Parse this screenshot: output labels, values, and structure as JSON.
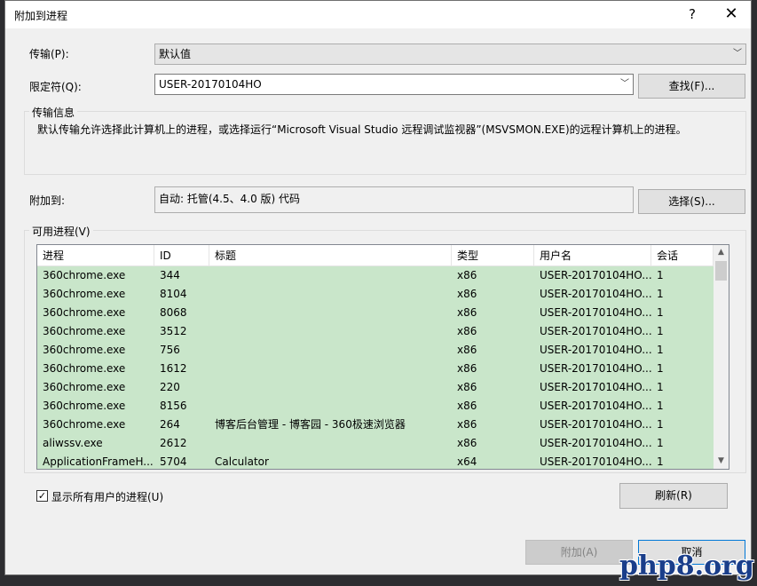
{
  "dialog": {
    "title": "附加到进程",
    "help_glyph": "?",
    "close_glyph": "✕"
  },
  "transport": {
    "label": "传输(P):",
    "value": "默认值"
  },
  "qualifier": {
    "label": "限定符(Q):",
    "value": "USER-20170104HO",
    "find_button": "查找(F)..."
  },
  "transport_info": {
    "title": "传输信息",
    "text": "默认传输允许选择此计算机上的进程，或选择运行“Microsoft Visual Studio 远程调试监视器”(MSVSMON.EXE)的远程计算机上的进程。"
  },
  "attach_to": {
    "label": "附加到:",
    "value": "自动: 托管(4.5、4.0 版) 代码",
    "select_button": "选择(S)..."
  },
  "processes": {
    "title": "可用进程(V)",
    "columns": [
      "进程",
      "ID",
      "标题",
      "类型",
      "用户名",
      "会话"
    ],
    "rows": [
      [
        "360chrome.exe",
        "344",
        "",
        "x86",
        "USER-20170104HO...",
        "1"
      ],
      [
        "360chrome.exe",
        "8104",
        "",
        "x86",
        "USER-20170104HO...",
        "1"
      ],
      [
        "360chrome.exe",
        "8068",
        "",
        "x86",
        "USER-20170104HO...",
        "1"
      ],
      [
        "360chrome.exe",
        "3512",
        "",
        "x86",
        "USER-20170104HO...",
        "1"
      ],
      [
        "360chrome.exe",
        "756",
        "",
        "x86",
        "USER-20170104HO...",
        "1"
      ],
      [
        "360chrome.exe",
        "1612",
        "",
        "x86",
        "USER-20170104HO...",
        "1"
      ],
      [
        "360chrome.exe",
        "220",
        "",
        "x86",
        "USER-20170104HO...",
        "1"
      ],
      [
        "360chrome.exe",
        "8156",
        "",
        "x86",
        "USER-20170104HO...",
        "1"
      ],
      [
        "360chrome.exe",
        "264",
        "博客后台管理 - 博客园 - 360极速浏览器",
        "x86",
        "USER-20170104HO...",
        "1"
      ],
      [
        "aliwssv.exe",
        "2612",
        "",
        "x86",
        "USER-20170104HO...",
        "1"
      ],
      [
        "ApplicationFrameH...",
        "5704",
        "Calculator",
        "x64",
        "USER-20170104HO...",
        "1"
      ]
    ],
    "row_color": "#c9e6ca"
  },
  "show_all_users": {
    "label": "显示所有用户的进程(U)",
    "checked": true,
    "mark": "✓"
  },
  "buttons": {
    "refresh": "刷新(R)",
    "attach": "附加(A)",
    "cancel": "取消"
  },
  "watermark": "php8.org",
  "icons": {
    "chevron": "chevron-down-icon",
    "scroll_up": "▲",
    "scroll_down": "▼",
    "chevron_glyph": "﹀"
  }
}
